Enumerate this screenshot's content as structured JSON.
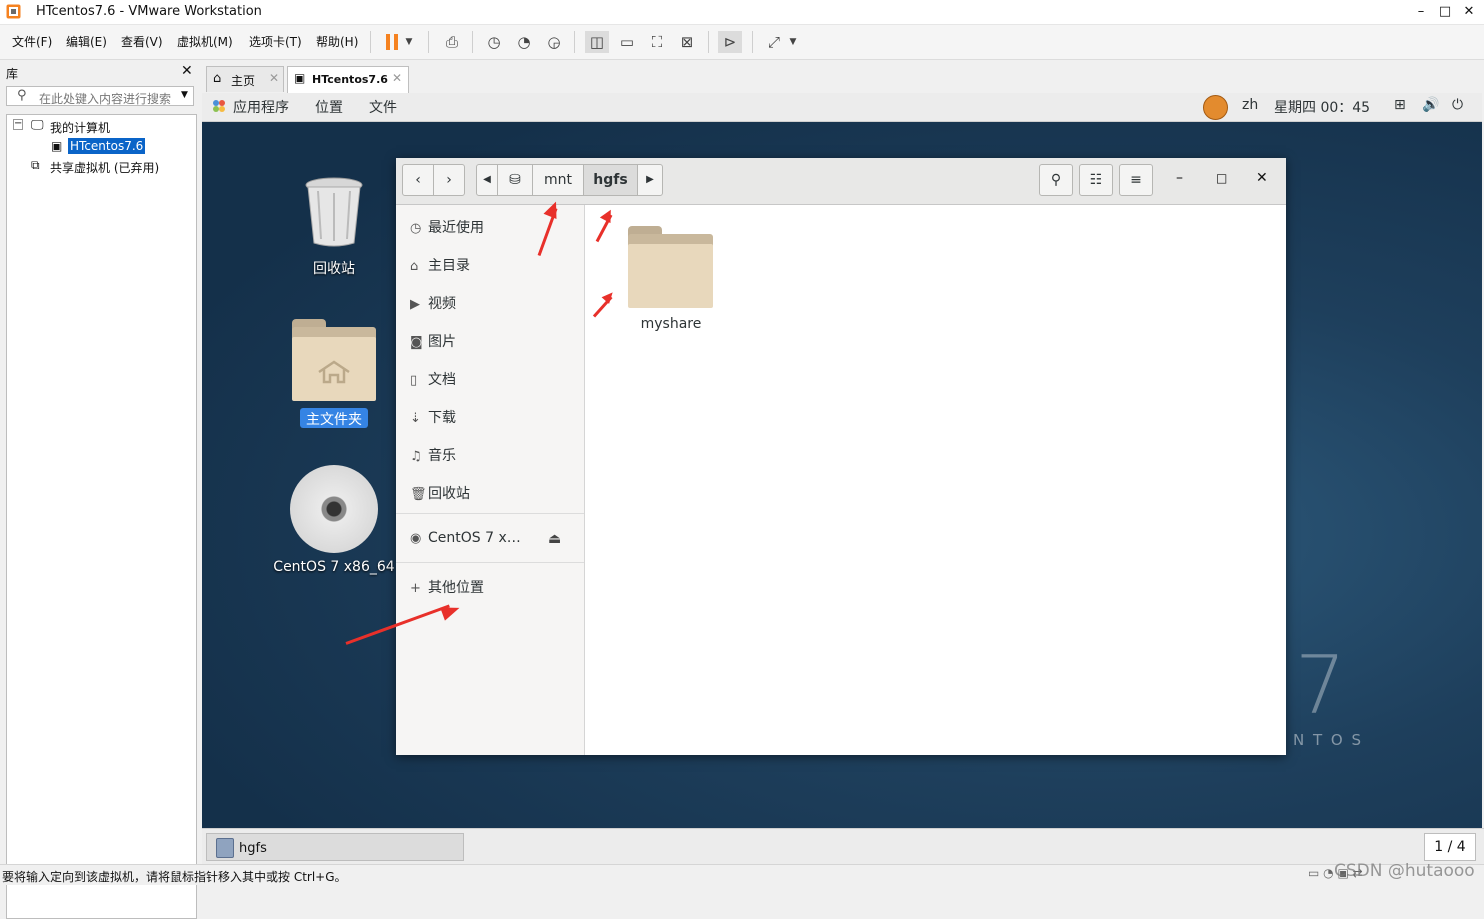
{
  "window": {
    "title": "HTcentos7.6 - VMware Workstation",
    "minimize": "–",
    "maximize": "□",
    "close": "✕"
  },
  "menu": [
    "文件(F)",
    "编辑(E)",
    "查看(V)",
    "虚拟机(M)",
    "选项卡(T)",
    "帮助(H)"
  ],
  "library": {
    "title": "库",
    "close": "✕",
    "search_placeholder": "在此处键入内容进行搜索",
    "tree": {
      "root": "我的计算机",
      "vm": "HTcentos7.6",
      "shared": "共享虚拟机 (已弃用)"
    }
  },
  "tabs": [
    {
      "label": "主页"
    },
    {
      "label": "HTcentos7.6"
    }
  ],
  "gnome_bar": {
    "apps": "应用程序",
    "places": "位置",
    "files": "文件",
    "lang": "zh",
    "clock": "星期四 00：45"
  },
  "desktop": {
    "trash": "回收站",
    "home": "主文件夹",
    "disc": "CentOS 7 x86_64",
    "watermark_num": "7",
    "watermark_text": "N T O S"
  },
  "nautilus": {
    "path": [
      "mnt",
      "hgfs"
    ],
    "sidebar": [
      "最近使用",
      "主目录",
      "视频",
      "图片",
      "文档",
      "下载",
      "音乐",
      "回收站"
    ],
    "device": "CentOS 7 x…",
    "other": "其他位置",
    "folder": "myshare"
  },
  "taskbar": {
    "item": "hgfs",
    "pager": "1 / 4"
  },
  "status": {
    "text": "要将输入定向到该虚拟机，请将鼠标指针移入其中或按 Ctrl+G。",
    "watermark": "CSDN @hutaooo"
  },
  "colors": {
    "accent": "#3584e4",
    "arrow": "#e8302a",
    "vmware_orange": "#f58220"
  }
}
